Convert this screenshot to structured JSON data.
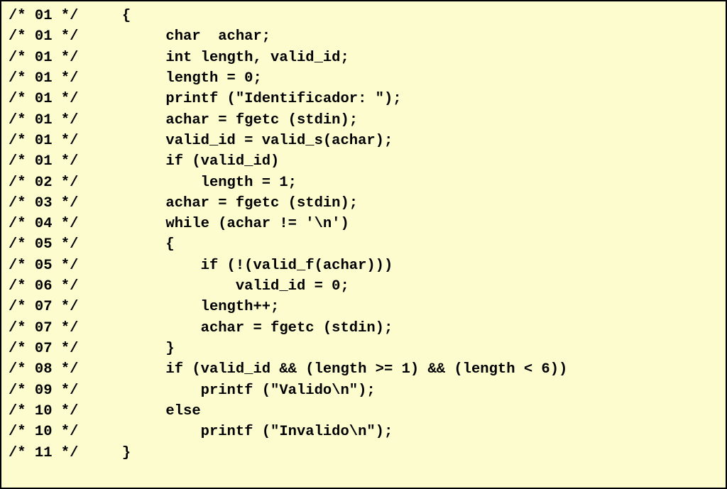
{
  "lines": [
    {
      "num": "01",
      "code": "     {"
    },
    {
      "num": "01",
      "code": "          char  achar;"
    },
    {
      "num": "01",
      "code": "          int length, valid_id;"
    },
    {
      "num": "01",
      "code": "          length = 0;"
    },
    {
      "num": "01",
      "code": "          printf (\"Identificador: \");"
    },
    {
      "num": "01",
      "code": "          achar = fgetc (stdin);"
    },
    {
      "num": "01",
      "code": "          valid_id = valid_s(achar);"
    },
    {
      "num": "01",
      "code": "          if (valid_id)"
    },
    {
      "num": "02",
      "code": "              length = 1;"
    },
    {
      "num": "03",
      "code": "          achar = fgetc (stdin);"
    },
    {
      "num": "04",
      "code": "          while (achar != '\\n')"
    },
    {
      "num": "05",
      "code": "          {"
    },
    {
      "num": "05",
      "code": "              if (!(valid_f(achar)))"
    },
    {
      "num": "06",
      "code": "                  valid_id = 0;"
    },
    {
      "num": "07",
      "code": "              length++;"
    },
    {
      "num": "07",
      "code": "              achar = fgetc (stdin);"
    },
    {
      "num": "07",
      "code": "          }"
    },
    {
      "num": "08",
      "code": "          if (valid_id && (length >= 1) && (length < 6))"
    },
    {
      "num": "09",
      "code": "              printf (\"Valido\\n\");"
    },
    {
      "num": "10",
      "code": "          else"
    },
    {
      "num": "10",
      "code": "              printf (\"Invalido\\n\");"
    },
    {
      "num": "11",
      "code": "     }"
    }
  ]
}
